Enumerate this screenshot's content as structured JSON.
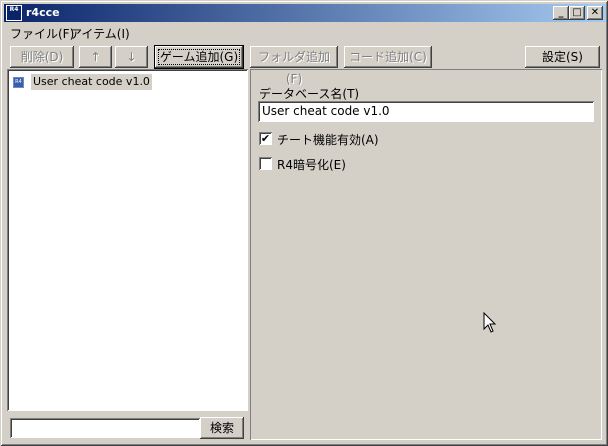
{
  "window": {
    "title": "r4cce",
    "icon_text": "R4",
    "controls": {
      "minimize": "_",
      "maximize": "□",
      "close": "✕"
    }
  },
  "menubar": {
    "items": [
      {
        "label": "ファイル(F)"
      },
      {
        "label": "アイテム(I)"
      }
    ]
  },
  "toolbar": {
    "delete_label": "削除(D)",
    "up_label": "↑",
    "down_label": "↓",
    "add_game_label": "ゲーム追加(G)",
    "add_folder_label": "フォルダ追加(F)",
    "add_code_label": "コード追加(C)",
    "settings_label": "設定(S)"
  },
  "tree": {
    "items": [
      {
        "label": "User cheat code v1.0",
        "icon_text": "R4"
      }
    ]
  },
  "search": {
    "value": "",
    "button_label": "検索"
  },
  "details": {
    "db_name_label": "データベース名(T)",
    "db_name_value": "User cheat code v1.0",
    "cheat_enabled_label": "チート機能有効(A)",
    "cheat_enabled_checked": "✔",
    "r4_encrypt_label": "R4暗号化(E)",
    "r4_encrypt_checked": ""
  }
}
